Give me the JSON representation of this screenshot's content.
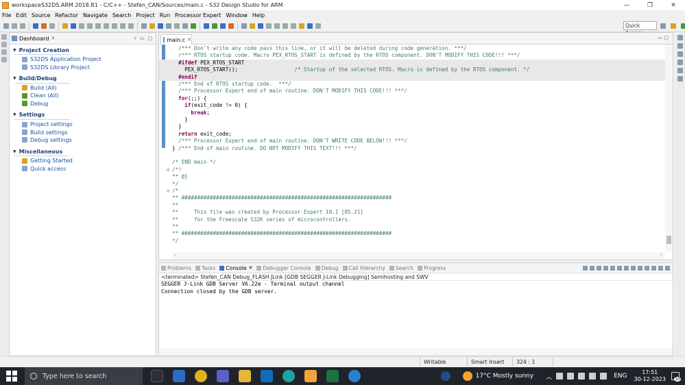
{
  "window": {
    "title": "workspaceS32DS.ARM.2018.R1 - C/C++ - Stefen_CAN/Sources/main.c - S32 Design Studio for ARM",
    "minimize": "—",
    "maximize": "❐",
    "close": "✕"
  },
  "menu": [
    "File",
    "Edit",
    "Source",
    "Refactor",
    "Navigate",
    "Search",
    "Project",
    "Run",
    "Processor Expert",
    "Window",
    "Help"
  ],
  "quick_access": "Quick Access",
  "dashboard": {
    "tab_label": "Dashboard",
    "sections": [
      {
        "title": "Project Creation",
        "items": [
          "S32DS Application Project",
          "S32DS Library Project"
        ]
      },
      {
        "title": "Build/Debug",
        "items": [
          "Build  (All)",
          "Clean  (All)",
          "Debug"
        ]
      },
      {
        "title": "Settings",
        "items": [
          "Project settings",
          "Build settings",
          "Debug settings"
        ]
      },
      {
        "title": "Miscellaneous",
        "items": [
          "Getting Started",
          "Quick access"
        ]
      }
    ]
  },
  "editor": {
    "tab_label": "main.c",
    "code_lines": [
      {
        "fold": "",
        "hl": false,
        "segs": [
          [
            "c",
            "  /*** Don't write any code pass this line, or it will be deleted during code generation. ***/"
          ]
        ]
      },
      {
        "fold": "",
        "hl": false,
        "segs": [
          [
            "c",
            "  /*** RTOS startup code. Macro PEX_RTOS_START is defined by the RTOS component. DON'T MODIFY THIS CODE!!! ***/"
          ]
        ]
      },
      {
        "fold": "",
        "hl": true,
        "segs": [
          [
            "p",
            "  #ifdef"
          ],
          [
            "t",
            " PEX_RTOS_START"
          ]
        ]
      },
      {
        "fold": "",
        "hl": true,
        "segs": [
          [
            "t",
            "    PEX_RTOS_START();"
          ],
          [
            "c",
            "                  /* Startup of the selected RTOS. Macro is defined by the RTOS component. */"
          ]
        ]
      },
      {
        "fold": "",
        "hl": true,
        "segs": [
          [
            "p",
            "  #endif"
          ]
        ]
      },
      {
        "fold": "",
        "hl": false,
        "segs": [
          [
            "c",
            "  /*** End of RTOS startup code.  ***/"
          ]
        ]
      },
      {
        "fold": "",
        "hl": false,
        "segs": [
          [
            "c",
            "  /*** Processor Expert end of main routine. DON'T MODIFY THIS CODE!!! ***/"
          ]
        ]
      },
      {
        "fold": "",
        "hl": false,
        "segs": [
          [
            "k",
            "  for"
          ],
          [
            "t",
            "(;;) {"
          ]
        ]
      },
      {
        "fold": "",
        "hl": false,
        "segs": [
          [
            "k",
            "    if"
          ],
          [
            "t",
            "(exit_code != 0) {"
          ]
        ]
      },
      {
        "fold": "",
        "hl": false,
        "segs": [
          [
            "k",
            "      break"
          ],
          [
            "t",
            ";"
          ]
        ]
      },
      {
        "fold": "",
        "hl": false,
        "segs": [
          [
            "t",
            "    }"
          ]
        ]
      },
      {
        "fold": "",
        "hl": false,
        "segs": [
          [
            "t",
            "  }"
          ]
        ]
      },
      {
        "fold": "",
        "hl": false,
        "segs": [
          [
            "k",
            "  return"
          ],
          [
            "t",
            " exit_code;"
          ]
        ]
      },
      {
        "fold": "",
        "hl": false,
        "segs": [
          [
            "c",
            "  /*** Processor Expert end of main routine. DON'T WRITE CODE BELOW!!! ***/"
          ]
        ]
      },
      {
        "fold": "",
        "hl": false,
        "segs": [
          [
            "t",
            "} "
          ],
          [
            "c",
            "/*** End of main routine. DO NOT MODIFY THIS TEXT!!! ***/"
          ]
        ]
      },
      {
        "fold": "",
        "hl": false,
        "segs": [
          [
            "t",
            ""
          ]
        ]
      },
      {
        "fold": "",
        "hl": false,
        "segs": [
          [
            "c",
            "/* END main */"
          ]
        ]
      },
      {
        "fold": "⊖",
        "hl": false,
        "segs": [
          [
            "c",
            "/*!"
          ]
        ]
      },
      {
        "fold": "",
        "hl": false,
        "segs": [
          [
            "c",
            "** @}"
          ]
        ]
      },
      {
        "fold": "",
        "hl": false,
        "segs": [
          [
            "c",
            "*/"
          ]
        ]
      },
      {
        "fold": "⊖",
        "hl": false,
        "segs": [
          [
            "c",
            "/*"
          ]
        ]
      },
      {
        "fold": "",
        "hl": false,
        "segs": [
          [
            "c",
            "** ###################################################################"
          ]
        ]
      },
      {
        "fold": "",
        "hl": false,
        "segs": [
          [
            "c",
            "**"
          ]
        ]
      },
      {
        "fold": "",
        "hl": false,
        "segs": [
          [
            "c",
            "**     This file was created by Processor Expert 10.1 [05.21]"
          ]
        ]
      },
      {
        "fold": "",
        "hl": false,
        "segs": [
          [
            "c",
            "**     for the Freescale S32K series of microcontrollers."
          ]
        ]
      },
      {
        "fold": "",
        "hl": false,
        "segs": [
          [
            "c",
            "**"
          ]
        ]
      },
      {
        "fold": "",
        "hl": false,
        "segs": [
          [
            "c",
            "** ###################################################################"
          ]
        ]
      },
      {
        "fold": "",
        "hl": false,
        "segs": [
          [
            "c",
            "*/"
          ]
        ]
      }
    ]
  },
  "console": {
    "tabs": [
      "Problems",
      "Tasks",
      "Console",
      "Debugger Console",
      "Debug",
      "Call Hierarchy",
      "Search",
      "Progress"
    ],
    "active_tab": "Console",
    "terminated": "<terminated> Stefen_CAN Debug_FLASH JLink [GDB SEGGER J-Link Debugging] Semihosting and SWV",
    "lines": [
      "SEGGER J-Link GDB Server V6.22e - Terminal output channel",
      "Connection closed by the GDB server."
    ]
  },
  "status": {
    "writable": "Writable",
    "insert_mode": "Smart Insert",
    "position": "324 : 1"
  },
  "taskbar": {
    "search_placeholder": "Type here to search",
    "weather": "17°C  Mostly sunny",
    "language": "ENG",
    "time": "17:51",
    "date": "30-12-2023",
    "notification_count": "10"
  }
}
